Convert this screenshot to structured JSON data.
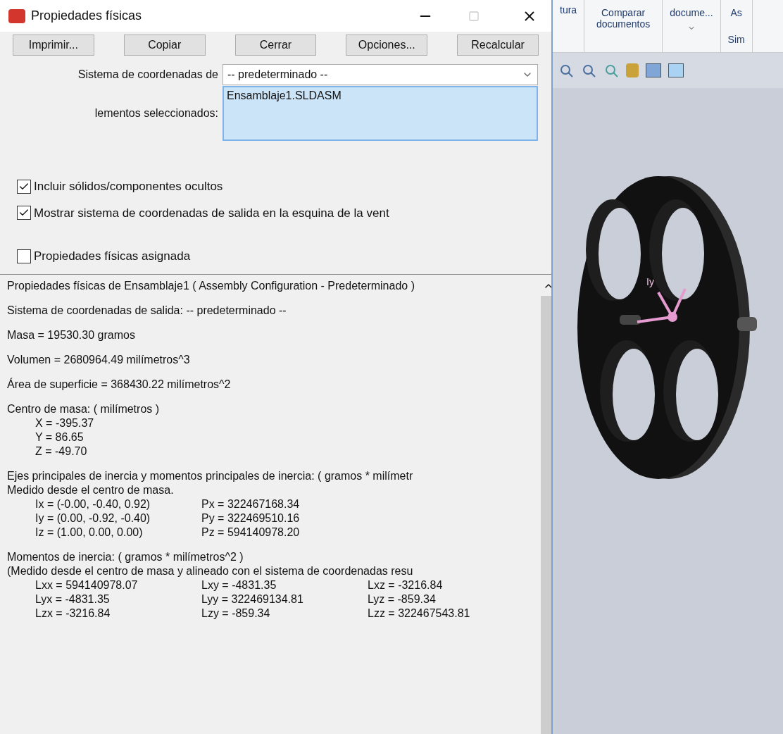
{
  "window": {
    "title": "Propiedades físicas"
  },
  "buttons": [
    "Imprimir...",
    "Copiar",
    "Cerrar",
    "Opciones...",
    "Recalcular"
  ],
  "coordinate_system": {
    "label": "Sistema de coordenadas de",
    "value": "-- predeterminado --"
  },
  "selected_items": {
    "label": "lementos seleccionados:",
    "items": [
      "Ensamblaje1.SLDASM"
    ]
  },
  "options": [
    {
      "label": "Incluir sólidos/componentes ocultos",
      "checked": true
    },
    {
      "label": "Mostrar sistema de coordenadas de salida en la esquina de la vent",
      "checked": true
    },
    {
      "label": "Propiedades físicas asignada",
      "checked": false
    }
  ],
  "results": [
    {
      "lines": [
        {
          "kind": "text",
          "text": "Propiedades físicas de Ensamblaje1 ( Assembly Configuration - Predeterminado )"
        }
      ]
    },
    {
      "lines": [
        {
          "kind": "text",
          "text": "Sistema de coordenadas de salida: -- predeterminado --"
        }
      ]
    },
    {
      "lines": [
        {
          "kind": "text",
          "text": "Masa = 19530.30 gramos"
        }
      ]
    },
    {
      "lines": [
        {
          "kind": "text",
          "text": "Volumen = 2680964.49 milímetros^3"
        }
      ]
    },
    {
      "lines": [
        {
          "kind": "text",
          "text": "Área de superficie = 368430.22 milímetros^2"
        }
      ]
    },
    {
      "lines": [
        {
          "kind": "text",
          "text": "Centro de masa: ( milímetros )"
        },
        {
          "kind": "row",
          "cells": [
            "X = -395.37"
          ]
        },
        {
          "kind": "row",
          "cells": [
            "Y = 86.65"
          ]
        },
        {
          "kind": "row",
          "cells": [
            "Z = -49.70"
          ]
        }
      ]
    },
    {
      "lines": [
        {
          "kind": "text",
          "text": "Ejes principales de inercia y momentos principales de inercia: ( gramos * milímetr"
        },
        {
          "kind": "text",
          "text": "Medido desde el centro de masa."
        },
        {
          "kind": "row",
          "cells": [
            "Ix = (-0.00, -0.40, 0.92)",
            "Px = 322467168.34"
          ]
        },
        {
          "kind": "row",
          "cells": [
            "Iy = (0.00, -0.92, -0.40)",
            "Py = 322469510.16"
          ]
        },
        {
          "kind": "row",
          "cells": [
            "Iz = (1.00, 0.00, 0.00)",
            "Pz = 594140978.20"
          ]
        }
      ]
    },
    {
      "lines": [
        {
          "kind": "text",
          "text": "Momentos de inercia: ( gramos * milímetros^2 )"
        },
        {
          "kind": "text",
          "text": "(Medido desde el centro de masa y alineado con el sistema de coordenadas resu"
        },
        {
          "kind": "row",
          "cells": [
            "Lxx = 594140978.07",
            "Lxy = -4831.35",
            "Lxz = -3216.84"
          ]
        },
        {
          "kind": "row",
          "cells": [
            "Lyx = -4831.35",
            "Lyy = 322469134.81",
            "Lyz = -859.34"
          ]
        },
        {
          "kind": "row",
          "cells": [
            "Lzx = -3216.84",
            "Lzy = -859.34",
            "Lzz = 322467543.81"
          ]
        }
      ]
    }
  ],
  "ribbon": [
    {
      "text": "tura"
    },
    {
      "text": "Comparar documentos"
    },
    {
      "text": "docume..."
    },
    {
      "text": "As"
    }
  ],
  "ribbon_bottom": [
    "Sim"
  ],
  "viewport": {
    "axis_label": "Iy"
  }
}
